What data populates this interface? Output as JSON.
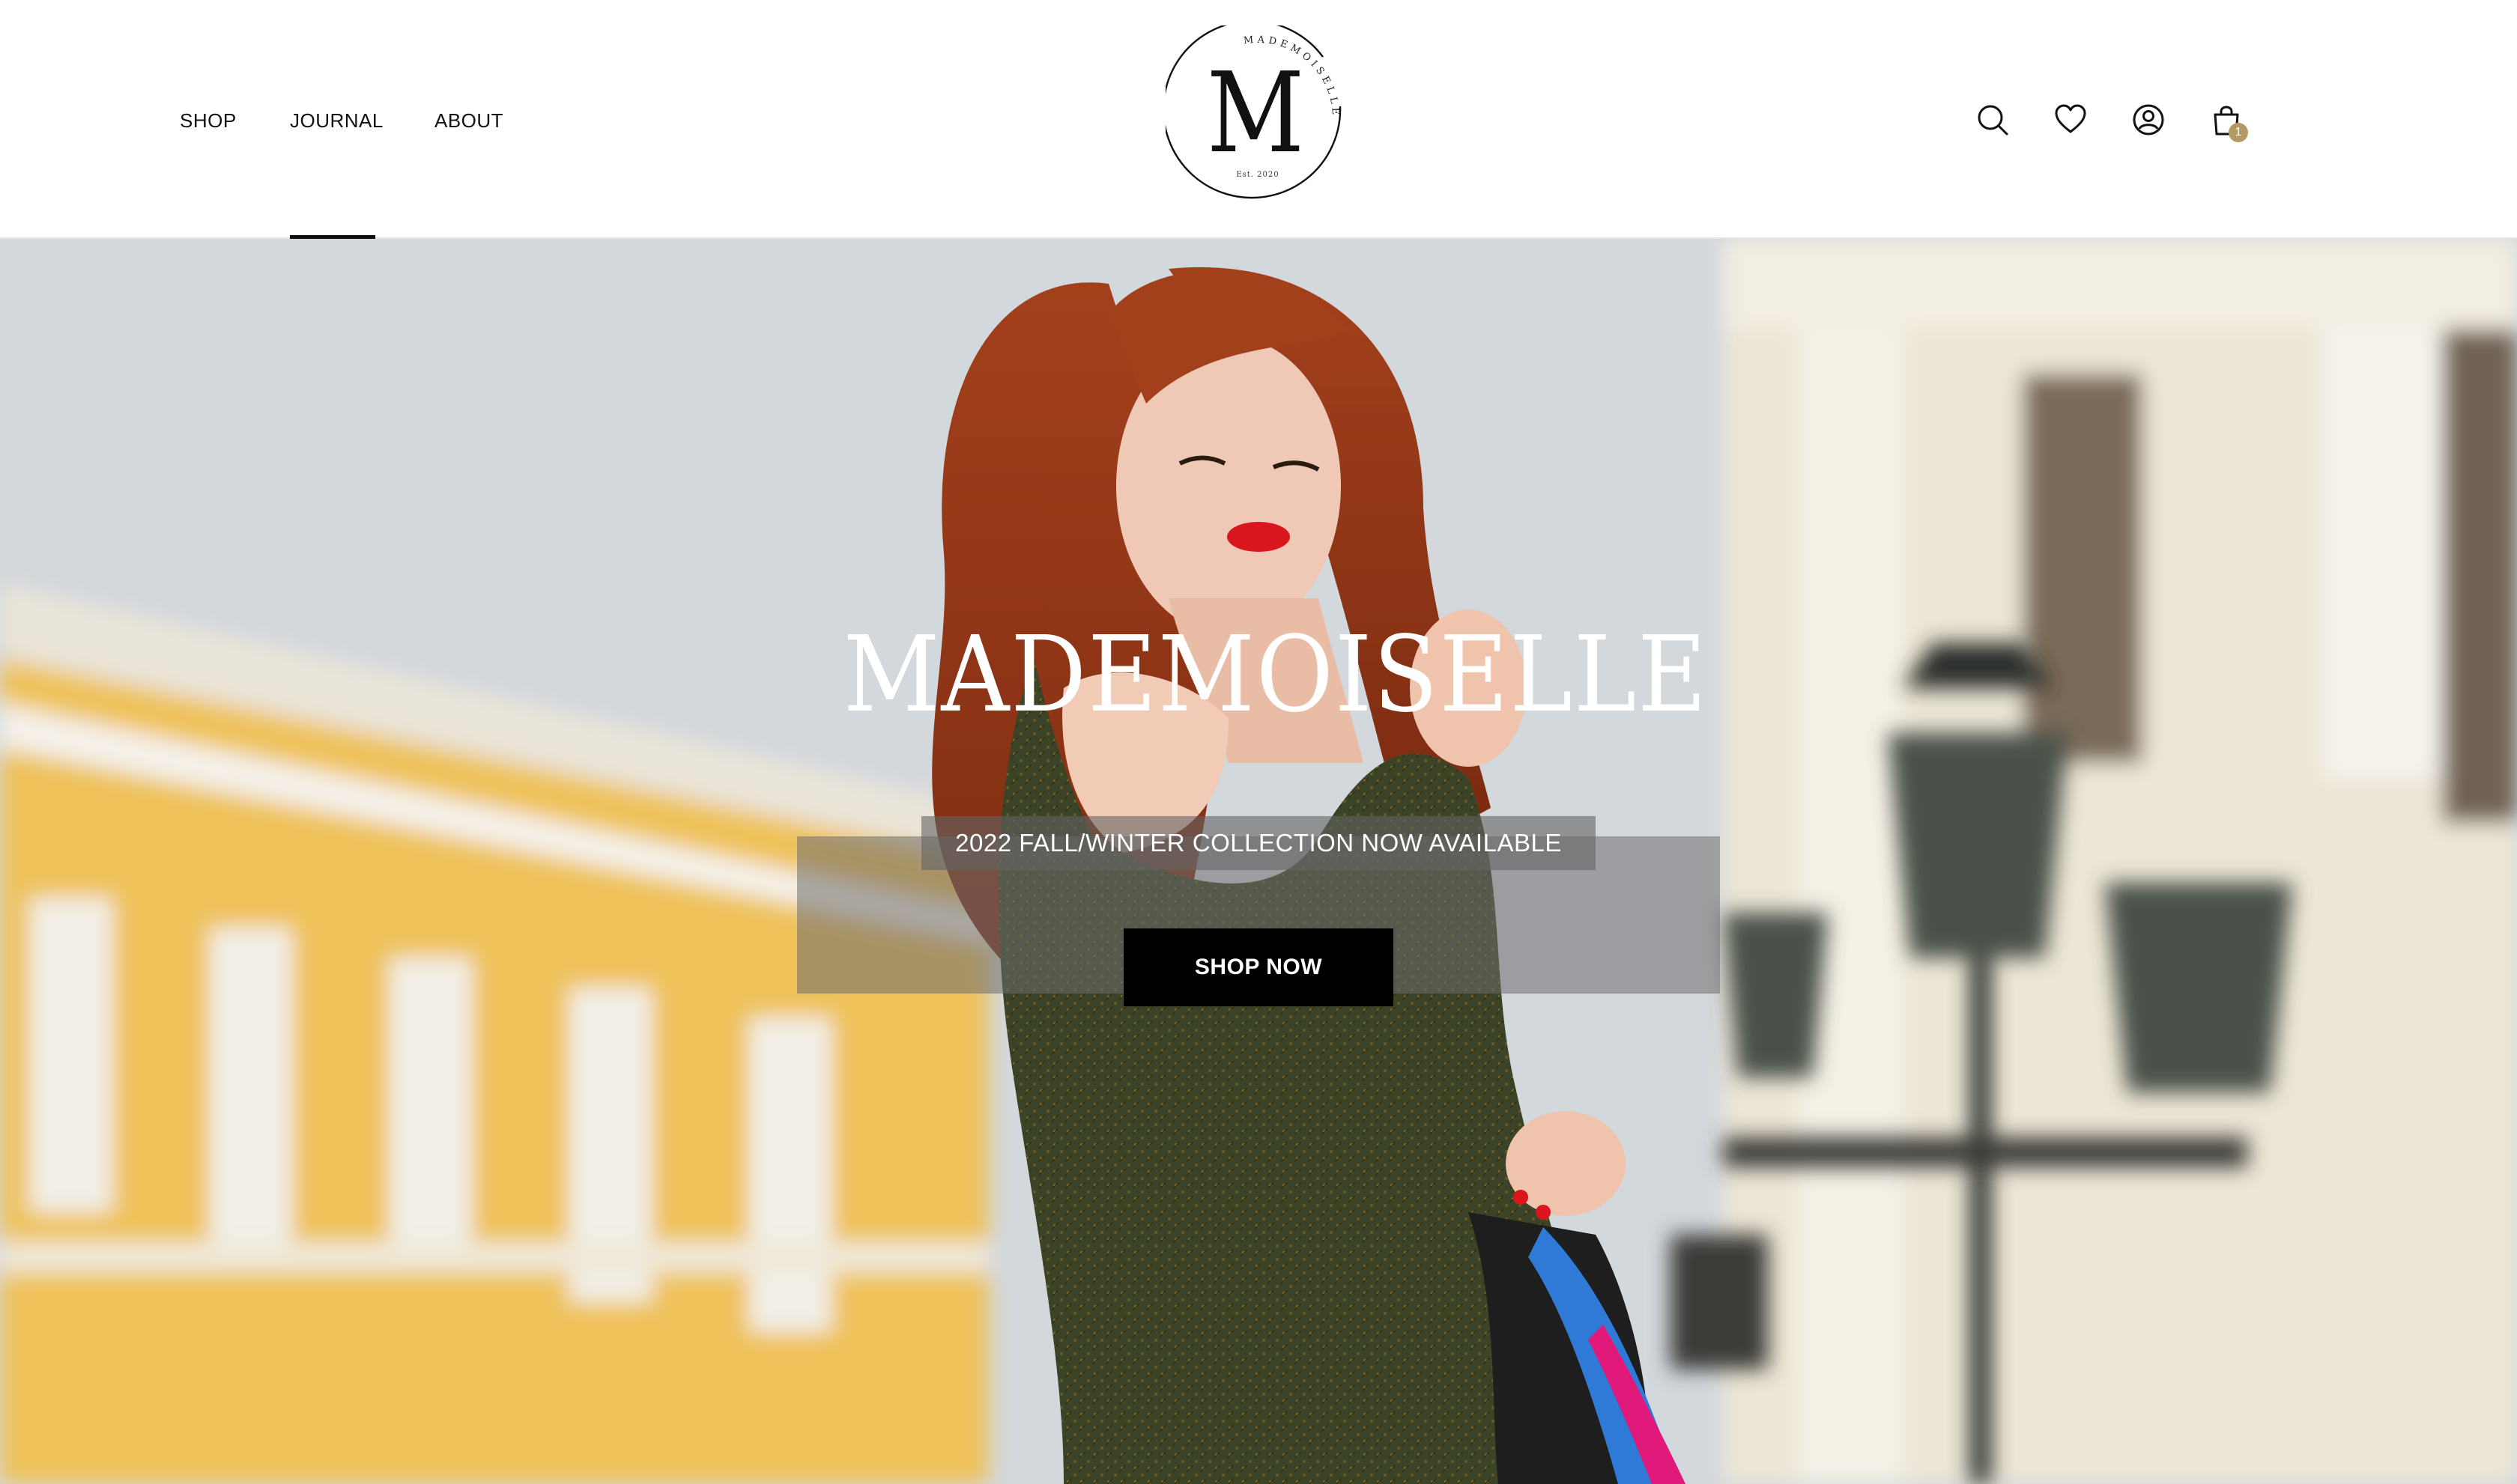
{
  "nav": {
    "items": [
      {
        "label": "SHOP"
      },
      {
        "label": "JOURNAL",
        "active": true
      },
      {
        "label": "ABOUT"
      }
    ]
  },
  "logo": {
    "letter": "M",
    "ring_text": "MADEMOISELLE",
    "est": "Est. 2020"
  },
  "header_icons": [
    "search-icon",
    "heart-icon",
    "account-icon",
    "shopping-bag-icon"
  ],
  "cart": {
    "count": "1",
    "badge_color": "#b49a62"
  },
  "hero": {
    "title": "MADEMOISELLE",
    "subtitle": "2022 FALL/WINTER COLLECTION NOW AVAILABLE",
    "cta_label": "SHOP NOW"
  },
  "colors": {
    "text": "#111111",
    "cta_bg": "#000000",
    "accent": "#b49a62"
  }
}
